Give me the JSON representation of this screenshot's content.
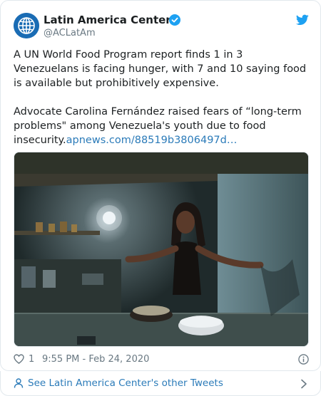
{
  "author": {
    "name": "Latin America Center",
    "handle": "@ACLatAm",
    "verified": true,
    "avatar_icon": "globe-logo-icon",
    "brand_color": "#1a6cb4"
  },
  "tweet": {
    "paragraph1": "A UN World Food Program report finds 1 in 3 Venezuelans is facing hunger, with 7 and 10 saying food is available but prohibitively expensive.",
    "paragraph2": "Advocate Carolina Fernández raised fears of “long-term problems\" among Venezuela's youth due to food insecurity.",
    "link": "apnews.com/88519b3806497d…"
  },
  "media": {
    "type": "photo"
  },
  "footer": {
    "like_count": "1",
    "timestamp": "9:55 PM - Feb 24, 2020"
  },
  "more_tweets": {
    "label": "See Latin America Center's other Tweets"
  },
  "colors": {
    "link": "#2b7bb9",
    "muted": "#697882",
    "twitter_blue": "#1da1f2",
    "border": "#e1e8ed"
  }
}
